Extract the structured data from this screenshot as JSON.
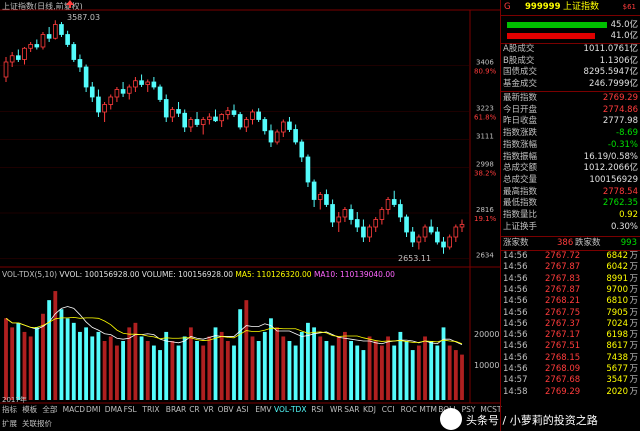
{
  "chart": {
    "title": "上证指数(日线,前复权)",
    "peak_label": "3587.03",
    "low_label": "2653.11",
    "price_levels": [
      {
        "value": "3406",
        "pct": "80.9%"
      },
      {
        "value": "3223",
        "pct": "61.8%"
      },
      {
        "value": "3111",
        "pct": ""
      },
      {
        "value": "2998",
        "pct": "38.2%"
      },
      {
        "value": "2816",
        "pct": "19.1%"
      },
      {
        "value": "2634",
        "pct": ""
      }
    ],
    "candles": [
      [
        3360,
        3440,
        3340,
        3420
      ],
      [
        3420,
        3460,
        3400,
        3445
      ],
      [
        3445,
        3470,
        3420,
        3430
      ],
      [
        3430,
        3480,
        3410,
        3475
      ],
      [
        3475,
        3500,
        3460,
        3490
      ],
      [
        3490,
        3510,
        3470,
        3480
      ],
      [
        3480,
        3540,
        3470,
        3530
      ],
      [
        3530,
        3560,
        3500,
        3515
      ],
      [
        3515,
        3587,
        3510,
        3570
      ],
      [
        3570,
        3580,
        3520,
        3530
      ],
      [
        3530,
        3545,
        3480,
        3490
      ],
      [
        3490,
        3500,
        3420,
        3430
      ],
      [
        3430,
        3450,
        3380,
        3400
      ],
      [
        3400,
        3410,
        3300,
        3320
      ],
      [
        3320,
        3340,
        3260,
        3280
      ],
      [
        3280,
        3310,
        3200,
        3220
      ],
      [
        3220,
        3260,
        3180,
        3250
      ],
      [
        3250,
        3290,
        3230,
        3280
      ],
      [
        3280,
        3320,
        3260,
        3310
      ],
      [
        3310,
        3340,
        3280,
        3295
      ],
      [
        3295,
        3330,
        3270,
        3320
      ],
      [
        3320,
        3360,
        3300,
        3345
      ],
      [
        3345,
        3370,
        3320,
        3330
      ],
      [
        3330,
        3350,
        3300,
        3340
      ],
      [
        3340,
        3360,
        3310,
        3320
      ],
      [
        3320,
        3330,
        3260,
        3270
      ],
      [
        3270,
        3290,
        3180,
        3200
      ],
      [
        3200,
        3240,
        3180,
        3230
      ],
      [
        3230,
        3260,
        3200,
        3215
      ],
      [
        3215,
        3230,
        3140,
        3160
      ],
      [
        3160,
        3200,
        3140,
        3190
      ],
      [
        3190,
        3220,
        3160,
        3170
      ],
      [
        3170,
        3200,
        3130,
        3190
      ],
      [
        3190,
        3215,
        3170,
        3200
      ],
      [
        3200,
        3230,
        3180,
        3185
      ],
      [
        3185,
        3215,
        3160,
        3210
      ],
      [
        3210,
        3240,
        3190,
        3225
      ],
      [
        3225,
        3250,
        3200,
        3210
      ],
      [
        3210,
        3220,
        3150,
        3160
      ],
      [
        3160,
        3200,
        3140,
        3190
      ],
      [
        3190,
        3230,
        3170,
        3220
      ],
      [
        3220,
        3235,
        3180,
        3190
      ],
      [
        3190,
        3200,
        3130,
        3145
      ],
      [
        3145,
        3170,
        3080,
        3100
      ],
      [
        3100,
        3150,
        3090,
        3140
      ],
      [
        3140,
        3190,
        3120,
        3180
      ],
      [
        3180,
        3200,
        3140,
        3150
      ],
      [
        3150,
        3170,
        3090,
        3100
      ],
      [
        3100,
        3110,
        3020,
        3040
      ],
      [
        3040,
        3050,
        2920,
        2940
      ],
      [
        2940,
        2950,
        2840,
        2870
      ],
      [
        2870,
        2900,
        2830,
        2890
      ],
      [
        2890,
        2910,
        2840,
        2850
      ],
      [
        2850,
        2870,
        2760,
        2780
      ],
      [
        2780,
        2820,
        2740,
        2800
      ],
      [
        2800,
        2840,
        2780,
        2830
      ],
      [
        2830,
        2850,
        2770,
        2790
      ],
      [
        2790,
        2820,
        2740,
        2760
      ],
      [
        2760,
        2790,
        2700,
        2720
      ],
      [
        2720,
        2770,
        2700,
        2760
      ],
      [
        2760,
        2800,
        2740,
        2790
      ],
      [
        2790,
        2840,
        2770,
        2830
      ],
      [
        2830,
        2880,
        2810,
        2870
      ],
      [
        2870,
        2905,
        2840,
        2850
      ],
      [
        2850,
        2870,
        2780,
        2800
      ],
      [
        2800,
        2810,
        2720,
        2740
      ],
      [
        2740,
        2760,
        2680,
        2700
      ],
      [
        2700,
        2730,
        2670,
        2720
      ],
      [
        2720,
        2770,
        2700,
        2760
      ],
      [
        2760,
        2790,
        2730,
        2740
      ],
      [
        2740,
        2760,
        2690,
        2700
      ],
      [
        2700,
        2720,
        2653,
        2680
      ],
      [
        2680,
        2730,
        2670,
        2720
      ],
      [
        2720,
        2770,
        2700,
        2760
      ],
      [
        2760,
        2790,
        2740,
        2770
      ]
    ],
    "volume": {
      "indicator": "VOL-TDX(5,10)",
      "vvol_label": "VVOL: 100156928.00",
      "volume_label": "VOLUME: 100156928.00",
      "ma5_label": "MA5: 110126320.00",
      "ma10_label": "MA10: 110139040.00",
      "axis_labels": [
        "20000",
        "10000"
      ],
      "bars": [
        18000,
        16000,
        17000,
        15000,
        14000,
        16000,
        19000,
        22000,
        24000,
        20000,
        18000,
        17000,
        15000,
        16000,
        14000,
        15000,
        13000,
        14000,
        12000,
        13000,
        16000,
        17000,
        14000,
        13000,
        12000,
        11000,
        15000,
        13000,
        12000,
        14000,
        16000,
        13000,
        12000,
        14000,
        16000,
        15000,
        13000,
        12000,
        20000,
        22000,
        14000,
        13000,
        15000,
        18000,
        16000,
        14000,
        13000,
        12000,
        15000,
        17000,
        16000,
        14000,
        13000,
        12000,
        14000,
        15000,
        13000,
        12000,
        11000,
        14000,
        13000,
        12000,
        14000,
        12000,
        15000,
        13000,
        11000,
        12000,
        14000,
        13000,
        12000,
        16000,
        12000,
        11000,
        10000
      ]
    },
    "year_label": "2017年",
    "tabs": [
      "指标",
      "模板",
      "全部",
      "MACD",
      "DMI",
      "DMA",
      "FSL",
      "TRIX",
      "BRAR",
      "CR",
      "VR",
      "OBV",
      "ASI",
      "EMV",
      "VOL-TDX",
      "RSI",
      "WR",
      "SAR",
      "KDJ",
      "CCI",
      "ROC",
      "MTM",
      "BOLL",
      "PSY",
      "MCST"
    ],
    "bottom_tabs": [
      "扩展",
      "关联报价"
    ]
  },
  "quote": {
    "code": "999999",
    "name": "上证指数",
    "badge": "$61",
    "bar1_value": "45.0亿",
    "bar2_value": "41.0亿",
    "turnovers": [
      {
        "label": "A股成交",
        "value": "1011.0761亿"
      },
      {
        "label": "B股成交",
        "value": "1.1306亿"
      },
      {
        "label": "国债成交",
        "value": "8295.5947亿"
      },
      {
        "label": "基金成交",
        "value": "246.7999亿"
      }
    ],
    "stats": [
      {
        "label": "最新指数",
        "value": "2769.29",
        "color": "red"
      },
      {
        "label": "今日开盘",
        "value": "2774.86",
        "color": "red"
      },
      {
        "label": "昨日收盘",
        "value": "2777.98",
        "color": "white"
      },
      {
        "label": "指数涨跌",
        "value": "-8.69",
        "color": "green"
      },
      {
        "label": "指数涨幅",
        "value": "-0.31%",
        "color": "green"
      },
      {
        "label": "指数振幅",
        "value": "16.19/0.58%",
        "color": "white"
      },
      {
        "label": "总成交额",
        "value": "1012.2066亿",
        "color": "white"
      },
      {
        "label": "总成交量",
        "value": "100156929",
        "color": "white"
      },
      {
        "label": "最高指数",
        "value": "2778.54",
        "color": "red"
      },
      {
        "label": "最低指数",
        "value": "2762.35",
        "color": "green"
      },
      {
        "label": "指数量比",
        "value": "0.92",
        "color": "yellow"
      },
      {
        "label": "上证换手",
        "value": "0.30%",
        "color": "white"
      }
    ],
    "advance_label": "涨家数",
    "advance_count": "386",
    "decline_label": "跌家数",
    "decline_count": "993",
    "ticks": [
      {
        "time": "14:56",
        "price": "2767.72",
        "vol": "6842",
        "unit": "万"
      },
      {
        "time": "14:56",
        "price": "2767.87",
        "vol": "6042",
        "unit": "万"
      },
      {
        "time": "14:56",
        "price": "2767.83",
        "vol": "8991",
        "unit": "万"
      },
      {
        "time": "14:56",
        "price": "2767.87",
        "vol": "9700",
        "unit": "万"
      },
      {
        "time": "14:56",
        "price": "2768.21",
        "vol": "6810",
        "unit": "万"
      },
      {
        "time": "14:56",
        "price": "2767.75",
        "vol": "7905",
        "unit": "万"
      },
      {
        "time": "14:56",
        "price": "2767.37",
        "vol": "7024",
        "unit": "万"
      },
      {
        "time": "14:56",
        "price": "2767.17",
        "vol": "6198",
        "unit": "万"
      },
      {
        "time": "14:56",
        "price": "2767.51",
        "vol": "8617",
        "unit": "万"
      },
      {
        "time": "14:56",
        "price": "2768.15",
        "vol": "7438",
        "unit": "万"
      },
      {
        "time": "14:56",
        "price": "2768.09",
        "vol": "5677",
        "unit": "万"
      },
      {
        "time": "14:57",
        "price": "2767.68",
        "vol": "3547",
        "unit": "万"
      },
      {
        "time": "14:58",
        "price": "2769.29",
        "vol": "2020",
        "unit": "万"
      }
    ]
  },
  "watermark": "头条号 / 小萝莉的投资之路",
  "colors": {
    "up": "#ff3c3c",
    "down": "#54fcfc",
    "bg": "#000000",
    "frame": "#7a0000"
  }
}
